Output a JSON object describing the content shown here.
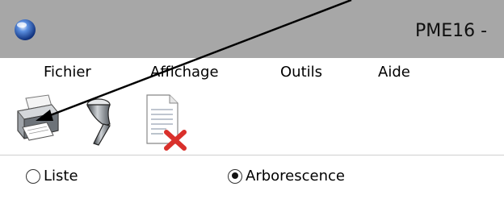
{
  "window": {
    "title": "PME16 -",
    "app_icon": "blue-orb-icon"
  },
  "menu": {
    "items": [
      {
        "label": "Fichier"
      },
      {
        "label": "Affichage"
      },
      {
        "label": "Outils"
      },
      {
        "label": "Aide"
      }
    ]
  },
  "toolbar": {
    "buttons": [
      {
        "icon": "printer-icon"
      },
      {
        "icon": "funnel-filter-icon"
      },
      {
        "icon": "delete-document-icon"
      }
    ]
  },
  "view_options": {
    "list_label": "Liste",
    "tree_label": "Arborescence",
    "selected": "Arborescence"
  },
  "colors": {
    "titlebar": "#a7a7a7",
    "delete_x": "#d9302b"
  }
}
